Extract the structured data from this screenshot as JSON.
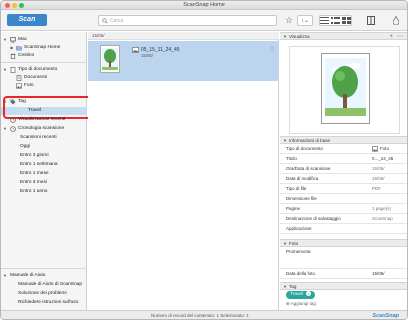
{
  "window": {
    "title": "ScanSnap Home"
  },
  "toolbar": {
    "scan_label": "Scan",
    "search_placeholder": "Cerca"
  },
  "sidebar": {
    "items": [
      {
        "label": "Mac",
        "icon": "computer-icon",
        "indent": 0
      },
      {
        "label": "ScanSnap Home",
        "icon": "folder-icon",
        "indent": 1
      },
      {
        "label": "Cestino",
        "icon": "trash-icon",
        "indent": 0
      },
      {
        "label": "Tipo di documento",
        "icon": "document-type-icon",
        "indent": 0
      },
      {
        "label": "Documenti",
        "icon": "document-icon",
        "indent": 1
      },
      {
        "label": "Foto",
        "icon": "photo-icon",
        "indent": 1
      },
      {
        "label": "Tag",
        "icon": "tag-icon",
        "indent": 0
      },
      {
        "label": "Travel",
        "icon": "",
        "indent": 1,
        "selected": true
      },
      {
        "label": "Visualizzazioni recenti",
        "icon": "clock-icon",
        "indent": 0
      },
      {
        "label": "Cronologia scansione",
        "icon": "history-icon",
        "indent": 0
      },
      {
        "label": "Scansioni recenti",
        "icon": "",
        "indent": 1
      },
      {
        "label": "Oggi",
        "icon": "",
        "indent": 1
      },
      {
        "label": "Entro 3 giorni",
        "icon": "",
        "indent": 1
      },
      {
        "label": "Entro 1 settimana",
        "icon": "",
        "indent": 1
      },
      {
        "label": "Entro 1 mese",
        "icon": "",
        "indent": 1
      },
      {
        "label": "Entro 3 mesi",
        "icon": "",
        "indent": 1
      },
      {
        "label": "Entro 1 anno",
        "icon": "",
        "indent": 1
      }
    ],
    "help": [
      "Manuale di Aiuto",
      "Manuale di Aiuto di ScanSnap",
      "Soluzione dei problemi",
      "Richiedere istruzioni sull'uso"
    ]
  },
  "list": {
    "group_header": "15/05/",
    "item": {
      "name": "05_15_11_24_45",
      "sub": "15/05/"
    }
  },
  "panel": {
    "preview_header": "Visualizza",
    "info_header": "Informazioni di base",
    "info_rows": [
      {
        "k": "Tipo di documento",
        "v": "Foto"
      },
      {
        "k": "Titolo",
        "v": "0..._24_45"
      },
      {
        "k": "Ora/Data di scansione",
        "v": "15/05/"
      },
      {
        "k": "Data di modifica",
        "v": "15/05/"
      },
      {
        "k": "Tipo di file",
        "v": "PDF"
      },
      {
        "k": "Dimensione file",
        "v": ""
      },
      {
        "k": "Pagine",
        "v": "1 page(s)"
      },
      {
        "k": "Destinazione di salvataggio",
        "v": "ScanSnap"
      },
      {
        "k": "Applicazione",
        "v": ""
      }
    ],
    "photo_header": "Foto",
    "photo_rows": [
      {
        "k": "Promemoria",
        "v": ""
      },
      {
        "k": "Data della foto",
        "v": "15/05/"
      }
    ],
    "tag_header": "Tag",
    "tag_value": "Travel",
    "add_tag": "Aggiungi tag"
  },
  "status": {
    "text": "Numero di record del contenuto: 1   Selezionato: 1",
    "brand": "ScanSnap"
  }
}
